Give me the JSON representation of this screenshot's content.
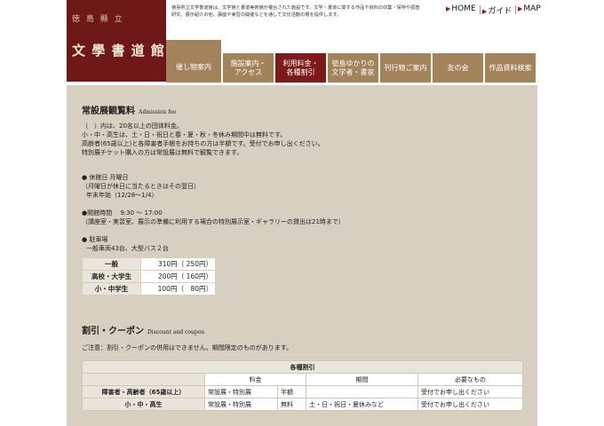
{
  "header": {
    "logo_small": "徳 島 縣 立",
    "logo_main": "文 學 書 道 館",
    "intro": "徳島県立文学書道館は、文学館と書道美術館が複合された施設です。文学・書道に関する作品や資料の収集・保存や調査研究、展示紹介の他、講座や実習の開催などを通して文化活動の場を提供します。"
  },
  "topnav": [
    {
      "label": "HOME"
    },
    {
      "label": "ガイド"
    },
    {
      "label": "MAP"
    }
  ],
  "nav": [
    {
      "label": "催し物案内"
    },
    {
      "label": "施設案内・\nアクセス"
    },
    {
      "label": "利用料金・\n各種割引"
    },
    {
      "label": "徳島ゆかりの\n文学者・書家"
    },
    {
      "label": "刊行物ご案内"
    },
    {
      "label": "友の会"
    },
    {
      "label": "作品資料検索"
    }
  ],
  "admission": {
    "title": "常設展観覧料",
    "title_en": "Admission fee",
    "note1": "（　）内は、20名以上の団体料金。",
    "note2": "小・中・高生は、土・日・祝日と春・夏・秋・冬休み期間中は無料です。",
    "note3": "高齢者(65歳以上)と各障害者手帳をお持ちの方は半額です。受付でお申し出ください。",
    "note4": "特別展チケット購入の方は常設展は無料で観覧できます。",
    "closed_head": "● 休館日 月曜日",
    "closed_1": "（月曜日が休日に当たるときはその翌日）",
    "closed_2": "年末年始（12/28〜1/4）",
    "hours_head": "●開館時間　 9:30 〜 17:00",
    "hours_1": "（講座室・実習室、展示の準備に利用する場合の特別展示室・ギャラリーの貸出は21時まで）",
    "parking_head": "● 駐車場",
    "parking_1": "一般車両43台、大型バス２台",
    "fees": [
      {
        "k": "一般",
        "v": "310円（ 250円）"
      },
      {
        "k": "高校・大学生",
        "v": "200円（ 160円）"
      },
      {
        "k": "小・中学生",
        "v": "100円（　80円）"
      }
    ]
  },
  "discount": {
    "title": "割引・クーポン",
    "title_en": "Discount and coupon",
    "note": "ご注意：割引・クーポンの併用はできません。期間限定のものがあります。",
    "caption": "各種割引",
    "head_fee": "料金",
    "head_period": "期間",
    "head_required": "必要なもの",
    "rows": [
      {
        "target": "障害者・高齢者（65歳以上）",
        "exhibit": "常設展・特別展",
        "rate": "半額",
        "period": "",
        "required": "受付でお申し出ください"
      },
      {
        "target": "小・中・高生",
        "exhibit": "常設展・特別展",
        "rate": "無料",
        "period": "土・日・祝日・夏休みなど",
        "required": "受付でお申し出ください"
      }
    ]
  }
}
